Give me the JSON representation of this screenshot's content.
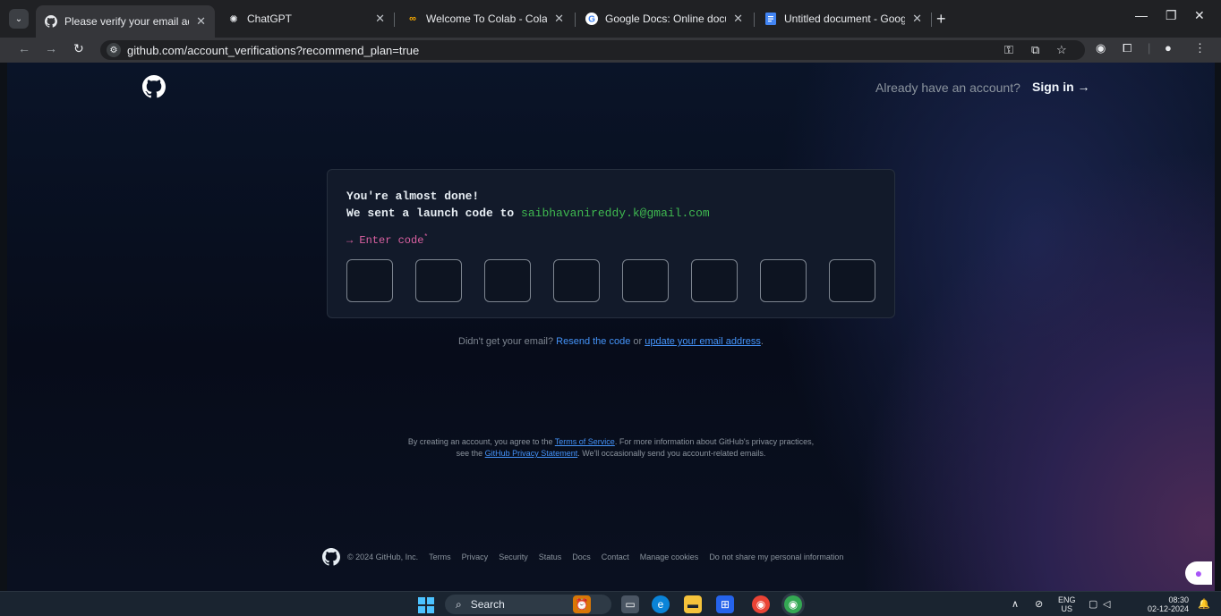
{
  "browser": {
    "tabs": [
      {
        "title": "Please verify your email address",
        "favicon": "github-icon",
        "active": true
      },
      {
        "title": "ChatGPT",
        "favicon": "chatgpt-icon",
        "active": false
      },
      {
        "title": "Welcome To Colab - Colab",
        "favicon": "colab-icon",
        "active": false
      },
      {
        "title": "Google Docs: Online document",
        "favicon": "google-icon",
        "active": false
      },
      {
        "title": "Untitled document - Google Do",
        "favicon": "docs-icon",
        "active": false
      }
    ],
    "url": "github.com/account_verifications?recommend_plan=true"
  },
  "header": {
    "already_text": "Already have an account?",
    "signin_label": "Sign in →"
  },
  "card": {
    "line1": "You're almost done!",
    "line2_prefix": "We sent a launch code to",
    "email": "saibhavanireddy.k@gmail.com",
    "enter_code_label": "→ Enter code",
    "required_mark": "*",
    "code_digits": [
      "",
      "",
      "",
      "",
      "",
      "",
      "",
      ""
    ]
  },
  "resend": {
    "prefix": "Didn't get your email?",
    "resend_link": "Resend the code",
    "or": "or",
    "update_link": "update your email address",
    "suffix": "."
  },
  "legal": {
    "part1": "By creating an account, you agree to the",
    "tos_link": "Terms of Service",
    "part2": ". For more information about GitHub's privacy practices,",
    "part3": "see the",
    "privacy_link": "GitHub Privacy Statement",
    "part4": ". We'll occasionally send you account-related emails."
  },
  "footer": {
    "copyright": "© 2024 GitHub, Inc.",
    "links": [
      "Terms",
      "Privacy",
      "Security",
      "Status",
      "Docs",
      "Contact",
      "Manage cookies",
      "Do not share my personal information"
    ]
  },
  "taskbar": {
    "search_label": "Search",
    "lang_top": "ENG",
    "lang_bottom": "US",
    "time": "08:30",
    "date": "02-12-2024"
  },
  "colors": {
    "accent_link": "#4493f8",
    "email_green": "#3fb950",
    "enter_code_pink": "#db61a2"
  }
}
